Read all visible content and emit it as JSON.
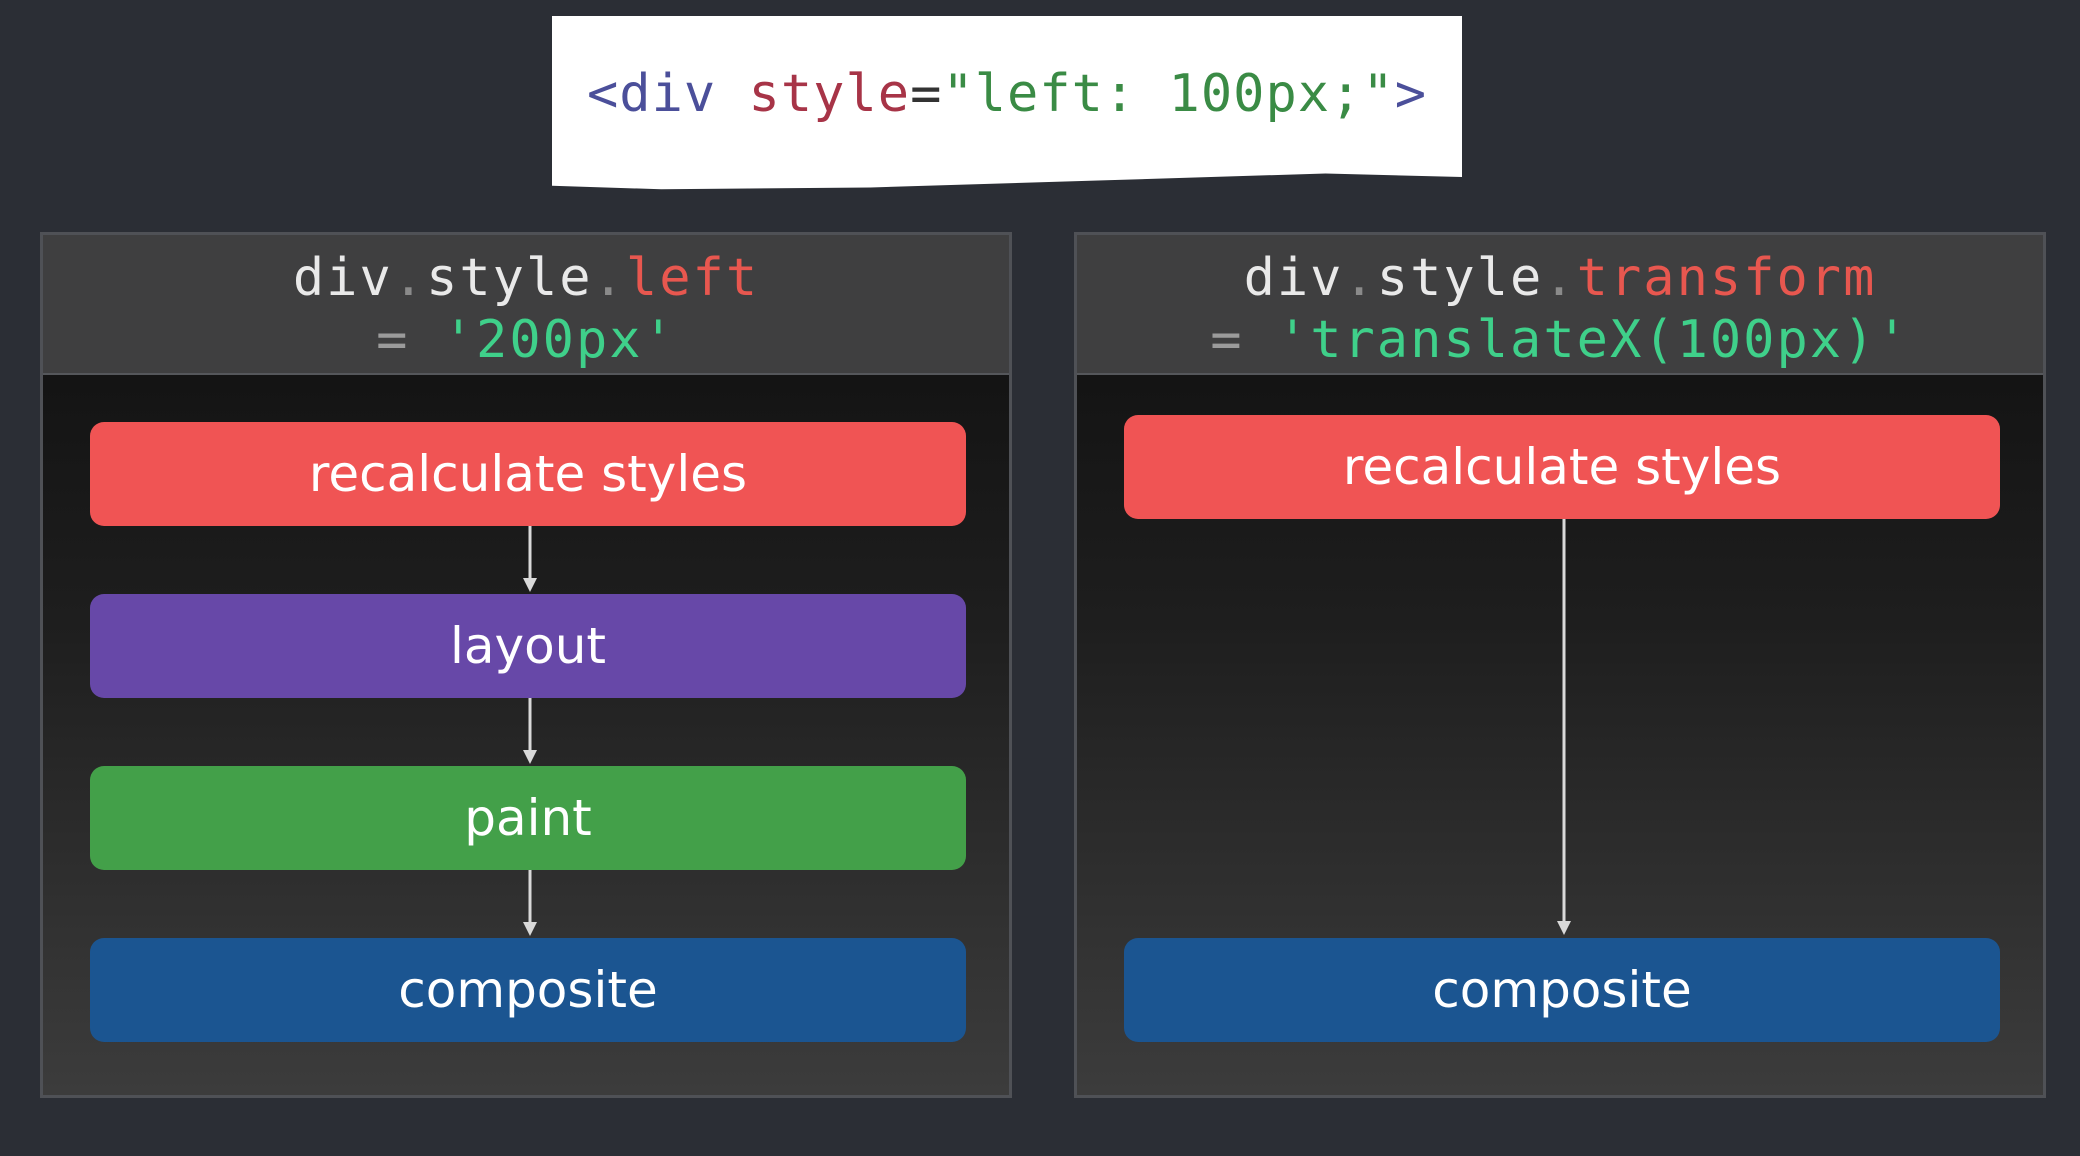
{
  "code": {
    "tag_open": "<div",
    "attr": " style",
    "eq": "=",
    "value": "\"left: 100px;\"",
    "tag_close": ">"
  },
  "left_panel": {
    "object": "div",
    "dot1": ".",
    "style": "style",
    "dot2": ".",
    "property": "left",
    "equals": "=",
    "value": "'200px'",
    "stages": [
      "recalculate styles",
      "layout",
      "paint",
      "composite"
    ]
  },
  "right_panel": {
    "object": "div",
    "dot1": ".",
    "style": "style",
    "dot2": ".",
    "property": "transform",
    "equals": "=",
    "value": "'translateX(100px)'",
    "stages": [
      "recalculate styles",
      "composite"
    ]
  },
  "colors": {
    "recalculate": "#f05454",
    "layout": "#6748a8",
    "paint": "#43a049",
    "composite": "#1b5591"
  }
}
